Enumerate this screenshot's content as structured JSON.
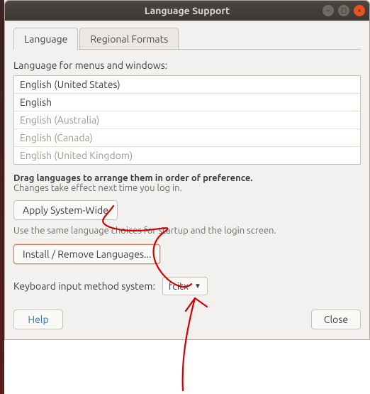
{
  "window": {
    "title": "Language Support"
  },
  "tabs": [
    {
      "label": "Language",
      "active": true
    },
    {
      "label": "Regional Formats",
      "active": false
    }
  ],
  "main": {
    "list_label": "Language for menus and windows:",
    "languages": [
      {
        "name": "English (United States)",
        "enabled": true
      },
      {
        "name": "English",
        "enabled": true
      },
      {
        "name": "English (Australia)",
        "enabled": false
      },
      {
        "name": "English (Canada)",
        "enabled": false
      },
      {
        "name": "English (United Kingdom)",
        "enabled": false
      }
    ],
    "drag_hint_bold": "Drag languages to arrange them in order of preference.",
    "drag_hint_sub": "Changes take effect next time you log in.",
    "apply_button": "Apply System-Wide",
    "apply_caption": "Use the same language choices for startup and the login screen.",
    "install_button": "Install / Remove Languages...",
    "keyboard_label": "Keyboard input method system:",
    "keyboard_value": "fcitx"
  },
  "footer": {
    "help": "Help",
    "close": "Close"
  },
  "colors": {
    "accent": "#e95420",
    "annotation": "#d40000"
  }
}
